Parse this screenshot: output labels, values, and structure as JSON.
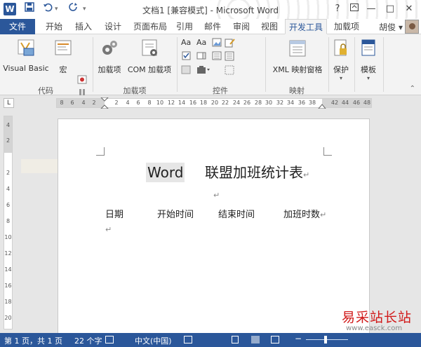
{
  "titlebar": {
    "title": "文档1 [兼容模式] - Microsoft Word",
    "word_logo": "W",
    "help_label": "?",
    "minimize_label": "—",
    "restore_label": "□",
    "close_label": "✕"
  },
  "tabs": {
    "file": "文件",
    "items": [
      "开始",
      "插入",
      "设计",
      "页面布局",
      "引用",
      "邮件",
      "审阅",
      "视图",
      "开发工具",
      "加载项"
    ],
    "active": "开发工具",
    "user": "胡俊"
  },
  "ribbon": {
    "visual_basic": "Visual Basic",
    "macro": "宏",
    "addins": "加载项",
    "com_addins": "COM 加载项",
    "xml_mapping": "XML 映射窗格",
    "protect": "保护",
    "template": "模板",
    "groups": {
      "code": "代码",
      "addins": "加载项",
      "controls": "控件",
      "mapping": "映射"
    }
  },
  "ruler": {
    "corner": "L",
    "h_ticks": [
      "8",
      "6",
      "4",
      "2",
      "2",
      "4",
      "6",
      "8",
      "10",
      "12",
      "14",
      "16",
      "18",
      "20",
      "22",
      "24",
      "26",
      "28",
      "30",
      "32",
      "34",
      "36",
      "38",
      "42",
      "44",
      "46",
      "48"
    ],
    "v_ticks": [
      "4",
      "2",
      "2",
      "4",
      "6",
      "8",
      "10",
      "12",
      "14",
      "16",
      "18",
      "20"
    ]
  },
  "document": {
    "title_highlight": "Word",
    "title_rest": "联盟加班统计表",
    "columns": [
      "日期",
      "开始时间",
      "结束时间",
      "加班时数"
    ],
    "para_mark": "↵"
  },
  "statusbar": {
    "page": "第 1 页，共 1 页",
    "words": "22 个字",
    "language": "中文(中国)"
  },
  "watermark": {
    "brand": "易采站长站",
    "url": "www.easck.com"
  },
  "colors": {
    "accent": "#2b579a",
    "ribbon_bg": "#f3f3f3",
    "watermark_red": "#d11a1a"
  }
}
